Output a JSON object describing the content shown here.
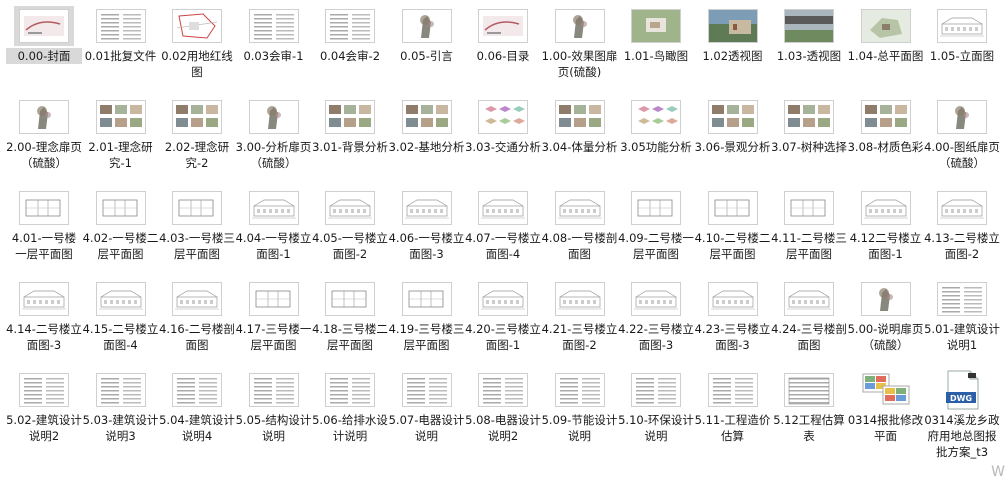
{
  "files": [
    {
      "name": "0.00-封面",
      "thumb": "cover",
      "selected": true
    },
    {
      "name": "0.01批复文件",
      "thumb": "doc"
    },
    {
      "name": "0.02用地红线图",
      "thumb": "map"
    },
    {
      "name": "0.03会审-1",
      "thumb": "doc"
    },
    {
      "name": "0.04会审-2",
      "thumb": "doc"
    },
    {
      "name": "0.05-引言",
      "thumb": "sketch"
    },
    {
      "name": "0.06-目录",
      "thumb": "cover"
    },
    {
      "name": "1.00-效果图扉页(硫酸)",
      "thumb": "sketch"
    },
    {
      "name": "1.01-鸟瞰图",
      "thumb": "aerial"
    },
    {
      "name": "1.02透视图",
      "thumb": "photo"
    },
    {
      "name": "1.03-透视图",
      "thumb": "photo2"
    },
    {
      "name": "1.04-总平面图",
      "thumb": "site"
    },
    {
      "name": "1.05-立面图",
      "thumb": "elev"
    },
    {
      "name": "2.00-理念扉页（硫酸）",
      "thumb": "sketch"
    },
    {
      "name": "2.01-理念研究-1",
      "thumb": "collage"
    },
    {
      "name": "2.02-理念研究-2",
      "thumb": "collage"
    },
    {
      "name": "3.00-分析扉页（硫酸）",
      "thumb": "sketch"
    },
    {
      "name": "3.01-背景分析",
      "thumb": "collage"
    },
    {
      "name": "3.02-基地分析",
      "thumb": "collage"
    },
    {
      "name": "3.03-交通分析",
      "thumb": "diagram"
    },
    {
      "name": "3.04-体量分析",
      "thumb": "collage"
    },
    {
      "name": "3.05功能分析",
      "thumb": "diagram"
    },
    {
      "name": "3.06-景观分析",
      "thumb": "collage"
    },
    {
      "name": "3.07-树种选择",
      "thumb": "collage"
    },
    {
      "name": "3.08-材质色彩",
      "thumb": "collage"
    },
    {
      "name": "4.00-图纸扉页（硫酸）",
      "thumb": "sketch"
    },
    {
      "name": "4.01-一号楼 一层平面图",
      "thumb": "plan"
    },
    {
      "name": "4.02-一号楼二层平面图",
      "thumb": "plan"
    },
    {
      "name": "4.03-一号楼三层平面图",
      "thumb": "plan"
    },
    {
      "name": "4.04-一号楼立面图-1",
      "thumb": "elev"
    },
    {
      "name": "4.05-一号楼立面图-2",
      "thumb": "elev"
    },
    {
      "name": "4.06-一号楼立面图-3",
      "thumb": "elev"
    },
    {
      "name": "4.07-一号楼立面图-4",
      "thumb": "elev"
    },
    {
      "name": "4.08-一号楼剖面图",
      "thumb": "elev"
    },
    {
      "name": "4.09-二号楼一层平面图",
      "thumb": "plan"
    },
    {
      "name": "4.10-二号楼二层平面图",
      "thumb": "plan"
    },
    {
      "name": "4.11-二号楼三层平面图",
      "thumb": "plan"
    },
    {
      "name": "4.12二号楼立面图-1",
      "thumb": "elev"
    },
    {
      "name": "4.13-二号楼立面图-2",
      "thumb": "elev"
    },
    {
      "name": "4.14-二号楼立面图-3",
      "thumb": "elev"
    },
    {
      "name": "4.15-二号楼立面图-4",
      "thumb": "elev"
    },
    {
      "name": "4.16-二号楼剖面图",
      "thumb": "elev"
    },
    {
      "name": "4.17-三号楼一层平面图",
      "thumb": "plan"
    },
    {
      "name": "4.18-三号楼二层平面图",
      "thumb": "plan"
    },
    {
      "name": "4.19-三号楼三层平面图",
      "thumb": "plan"
    },
    {
      "name": "4.20-三号楼立面图-1",
      "thumb": "elev"
    },
    {
      "name": "4.21-三号楼立面图-2",
      "thumb": "elev"
    },
    {
      "name": "4.22-三号楼立面图-3",
      "thumb": "elev"
    },
    {
      "name": "4.23-三号楼立面图-3",
      "thumb": "elev"
    },
    {
      "name": "4.24-三号楼剖面图",
      "thumb": "elev"
    },
    {
      "name": "5.00-说明扉页（硫酸）",
      "thumb": "sketch"
    },
    {
      "name": "5.01-建筑设计说明1",
      "thumb": "doc"
    },
    {
      "name": "5.02-建筑设计说明2",
      "thumb": "doc"
    },
    {
      "name": "5.03-建筑设计说明3",
      "thumb": "doc"
    },
    {
      "name": "5.04-建筑设计说明4",
      "thumb": "doc"
    },
    {
      "name": "5.05-结构设计说明",
      "thumb": "doc"
    },
    {
      "name": "5.06-给排水设计说明",
      "thumb": "doc"
    },
    {
      "name": "5.07-电器设计说明",
      "thumb": "doc"
    },
    {
      "name": "5.08-电器设计说明2",
      "thumb": "doc"
    },
    {
      "name": "5.09-节能设计说明",
      "thumb": "doc"
    },
    {
      "name": "5.10-环保设计说明",
      "thumb": "doc"
    },
    {
      "name": "5.11-工程造价估算",
      "thumb": "doc"
    },
    {
      "name": "5.12工程估算表",
      "thumb": "table"
    },
    {
      "name": "0314报批修改平面",
      "thumb": "multi"
    },
    {
      "name": "0314溪龙乡政府用地总图报批方案_t3",
      "thumb": "dwg"
    }
  ],
  "watermark": "W",
  "colors": {
    "selected": "#d9d9d9",
    "text": "#1a1a1a",
    "dwg_blue": "#2b5fa7"
  }
}
